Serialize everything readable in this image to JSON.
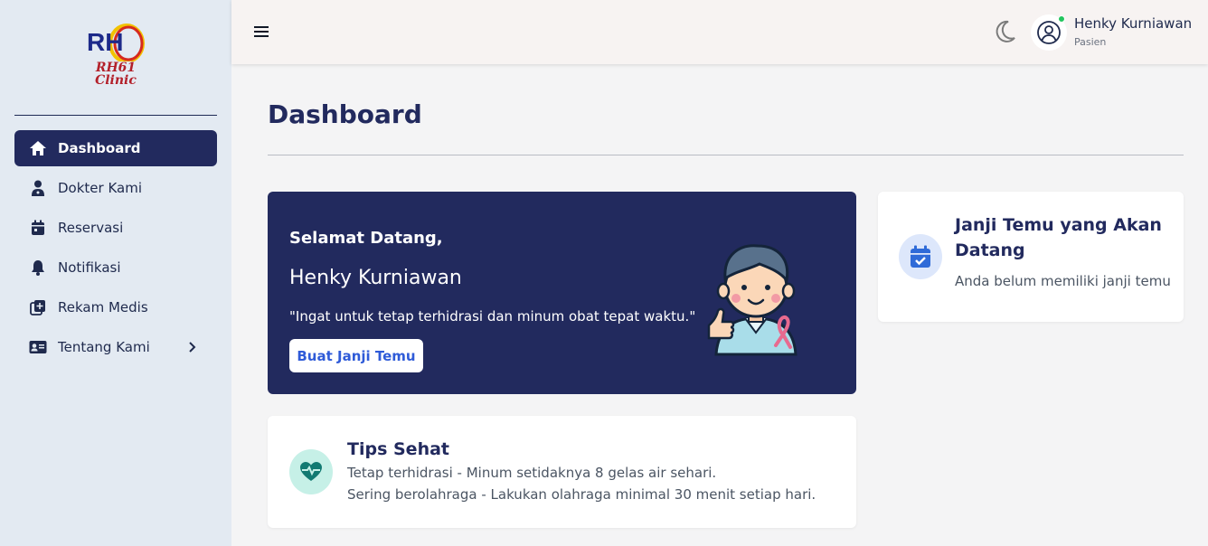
{
  "brand": {
    "logo_text": "RH",
    "logo_sub_1": "RH61",
    "logo_sub_2": "Clinic",
    "primary_color": "#222a5e",
    "accent_red": "#b3202a"
  },
  "sidebar": {
    "items": [
      {
        "label": "Dashboard",
        "icon": "home-icon",
        "active": true
      },
      {
        "label": "Dokter Kami",
        "icon": "doctor-icon"
      },
      {
        "label": "Reservasi",
        "icon": "calendar-icon"
      },
      {
        "label": "Notifikasi",
        "icon": "bell-icon"
      },
      {
        "label": "Rekam Medis",
        "icon": "medical-record-icon"
      },
      {
        "label": "Tentang Kami",
        "icon": "id-card-icon",
        "has_submenu": true
      }
    ]
  },
  "header": {
    "menu_icon": "hamburger-icon",
    "theme_icon": "moon-icon",
    "user_name": "Henky Kurniawan",
    "user_role": "Pasien",
    "online_color": "#22c55e"
  },
  "main": {
    "title": "Dashboard",
    "welcome": {
      "greeting": "Selamat Datang,",
      "name": "Henky Kurniawan",
      "quote": "\"Ingat untuk tetap terhidrasi dan minum obat tepat waktu.\"",
      "button_label": "Buat Janji Temu"
    },
    "tips": {
      "title": "Tips Sehat",
      "lines": [
        "Tetap terhidrasi - Minum setidaknya 8 gelas air sehari.",
        "Sering berolahraga - Lakukan olahraga minimal 30 menit setiap hari."
      ]
    },
    "appointment": {
      "title": "Janji Temu yang Akan Datang",
      "empty_text": "Anda belum memiliki janji temu"
    }
  }
}
